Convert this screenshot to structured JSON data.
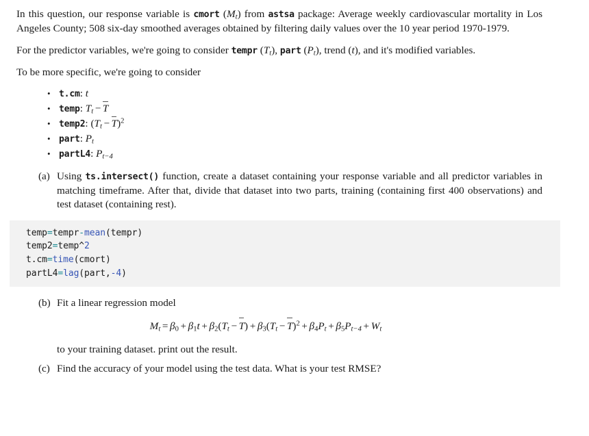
{
  "document": {
    "intro": {
      "p1": {
        "seg1": "In this question, our response variable is ",
        "code1": "cmort",
        "seg2": " (",
        "math1": "M",
        "math1_sub": "t",
        "seg3": ") from ",
        "code2": "astsa",
        "seg4": " package: Average weekly cardiovascular mortality in Los Angeles County; 508 six-day smoothed averages obtained by filtering daily values over the 10 year period 1970-1979."
      },
      "p2": {
        "seg1": "For the predictor variables, we're going to consider ",
        "code1": "tempr",
        "seg2": " (",
        "math1": "T",
        "math1_sub": "t",
        "seg3": "), ",
        "code2": "part",
        "seg4": " (",
        "math2": "P",
        "math2_sub": "t",
        "seg5": "), trend (",
        "math3": "t",
        "seg6": "), and it's modified variables."
      },
      "p3": "To be more specific, we're going to consider"
    },
    "variables": {
      "bullet_glyph": "•",
      "items": [
        {
          "name": "t.cm",
          "sep": ": ",
          "formula_plain": "t"
        },
        {
          "name": "temp",
          "sep": ": ",
          "formula_plain": "T_t - T-bar"
        },
        {
          "name": "temp2",
          "sep": ": ",
          "formula_plain": "(T_t - T-bar)^2"
        },
        {
          "name": "part",
          "sep": ": ",
          "formula_plain": "P_t"
        },
        {
          "name": "partL4",
          "sep": ": ",
          "formula_plain": "P_{t-4}"
        }
      ]
    },
    "questions": [
      {
        "label": "(a)",
        "seg1": "Using ",
        "code1": "ts.intersect()",
        "seg2": " function, create a dataset containing your response variable and all predictor variables in matching timeframe. After that, divide that dataset into two parts, training (containing first 400 observations) and test dataset (containing rest)."
      },
      {
        "label": "(b)",
        "text": "Fit a linear regression model",
        "followup": "to your training dataset. print out the result."
      },
      {
        "label": "(c)",
        "text": "Find the accuracy of your model using the test data. What is your test RMSE?"
      }
    ],
    "code_block": {
      "background": "#f2f2f2",
      "operator_color": "#1a8a93",
      "function_color": "#3755b5",
      "number_color": "#3755b5",
      "lines": [
        {
          "plain": "temp=tempr-mean(tempr)",
          "tokens": [
            {
              "t": "temp",
              "k": "plain"
            },
            {
              "t": "=",
              "k": "op"
            },
            {
              "t": "tempr",
              "k": "plain"
            },
            {
              "t": "-",
              "k": "op"
            },
            {
              "t": "mean",
              "k": "fn"
            },
            {
              "t": "(tempr)",
              "k": "plain"
            }
          ]
        },
        {
          "plain": "temp2=temp^2",
          "tokens": [
            {
              "t": "temp2",
              "k": "plain"
            },
            {
              "t": "=",
              "k": "op"
            },
            {
              "t": "temp",
              "k": "plain"
            },
            {
              "t": "^",
              "k": "plain"
            },
            {
              "t": "2",
              "k": "num"
            }
          ]
        },
        {
          "plain": "t.cm=time(cmort)",
          "tokens": [
            {
              "t": "t.cm",
              "k": "plain"
            },
            {
              "t": "=",
              "k": "op"
            },
            {
              "t": "time",
              "k": "fn"
            },
            {
              "t": "(cmort)",
              "k": "plain"
            }
          ]
        },
        {
          "plain": "partL4=lag(part,-4)",
          "tokens": [
            {
              "t": "partL4",
              "k": "plain"
            },
            {
              "t": "=",
              "k": "op"
            },
            {
              "t": "lag",
              "k": "fn"
            },
            {
              "t": "(part,",
              "k": "plain"
            },
            {
              "t": "-4",
              "k": "num"
            },
            {
              "t": ")",
              "k": "plain"
            }
          ]
        }
      ]
    },
    "equation": {
      "plain": "M_t = B_0 + B_1 t + B_2 (T_t - T-bar) + B_3 (T_t - T-bar)^2 + B_4 P_t + B_5 P_{t-4} + W_t",
      "beta": "β",
      "lhs": "M",
      "lhs_sub": "t",
      "terms": [
        {
          "coef_sub": "0"
        },
        {
          "coef_sub": "1",
          "var": "t"
        },
        {
          "coef_sub": "2"
        },
        {
          "coef_sub": "3"
        },
        {
          "coef_sub": "4",
          "var": "P",
          "var_sub": "t"
        },
        {
          "coef_sub": "5",
          "var": "P",
          "var_sub": "t−4"
        }
      ],
      "error": "W",
      "error_sub": "t"
    }
  }
}
